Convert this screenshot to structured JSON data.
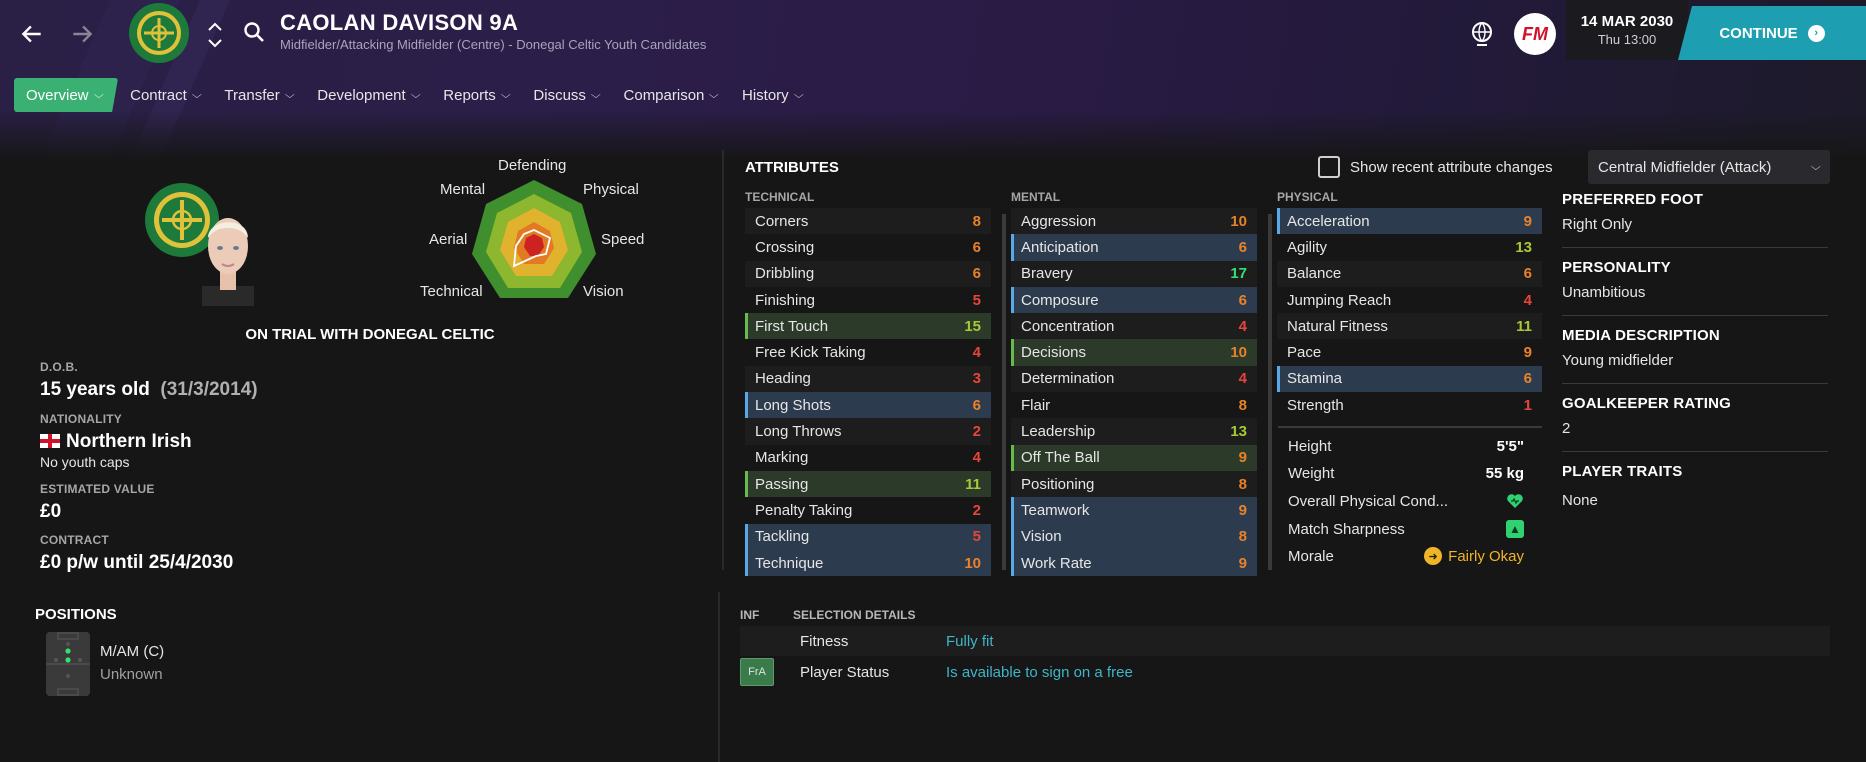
{
  "header": {
    "player_name": "CAOLAN DAVISON 9A",
    "subtitle": "Midfielder/Attacking Midfielder (Centre) - Donegal Celtic Youth Candidates",
    "date": "14 MAR 2030",
    "day_time": "Thu 13:00",
    "fm_logo": "FM",
    "continue_label": "CONTINUE",
    "accent_color": "#1d9fb1"
  },
  "tabs": [
    {
      "label": "Overview",
      "active": true
    },
    {
      "label": "Contract"
    },
    {
      "label": "Transfer"
    },
    {
      "label": "Development"
    },
    {
      "label": "Reports"
    },
    {
      "label": "Discuss"
    },
    {
      "label": "Comparison"
    },
    {
      "label": "History"
    }
  ],
  "radar": {
    "labels": {
      "defending": "Defending",
      "physical": "Physical",
      "speed": "Speed",
      "vision": "Vision",
      "technical": "Technical",
      "aerial": "Aerial",
      "mental": "Mental"
    }
  },
  "profile": {
    "trial_text": "ON TRIAL WITH DONEGAL CELTIC",
    "dob_label": "D.O.B.",
    "age": "15 years old",
    "dob": "(31/3/2014)",
    "nationality_label": "NATIONALITY",
    "nationality": "Northern Irish",
    "caps": "No youth caps",
    "value_label": "ESTIMATED VALUE",
    "value": "£0",
    "contract_label": "CONTRACT",
    "contract": "£0 p/w until 25/4/2030"
  },
  "attributes": {
    "title": "ATTRIBUTES",
    "show_changes_label": "Show recent attribute changes",
    "role": "Central Midfielder (Attack)",
    "technical_head": "TECHNICAL",
    "mental_head": "MENTAL",
    "physical_head": "PHYSICAL",
    "technical": [
      {
        "name": "Corners",
        "value": "8"
      },
      {
        "name": "Crossing",
        "value": "6"
      },
      {
        "name": "Dribbling",
        "value": "6"
      },
      {
        "name": "Finishing",
        "value": "5"
      },
      {
        "name": "First Touch",
        "value": "15",
        "hl": "green"
      },
      {
        "name": "Free Kick Taking",
        "value": "4"
      },
      {
        "name": "Heading",
        "value": "3"
      },
      {
        "name": "Long Shots",
        "value": "6",
        "hl": "blue"
      },
      {
        "name": "Long Throws",
        "value": "2"
      },
      {
        "name": "Marking",
        "value": "4"
      },
      {
        "name": "Passing",
        "value": "11",
        "hl": "green"
      },
      {
        "name": "Penalty Taking",
        "value": "2"
      },
      {
        "name": "Tackling",
        "value": "5",
        "hl": "blue"
      },
      {
        "name": "Technique",
        "value": "10",
        "hl": "blue"
      }
    ],
    "mental": [
      {
        "name": "Aggression",
        "value": "10"
      },
      {
        "name": "Anticipation",
        "value": "6",
        "hl": "blue"
      },
      {
        "name": "Bravery",
        "value": "17"
      },
      {
        "name": "Composure",
        "value": "6",
        "hl": "blue"
      },
      {
        "name": "Concentration",
        "value": "4"
      },
      {
        "name": "Decisions",
        "value": "10",
        "hl": "green"
      },
      {
        "name": "Determination",
        "value": "4"
      },
      {
        "name": "Flair",
        "value": "8"
      },
      {
        "name": "Leadership",
        "value": "13"
      },
      {
        "name": "Off The Ball",
        "value": "9",
        "hl": "green"
      },
      {
        "name": "Positioning",
        "value": "8"
      },
      {
        "name": "Teamwork",
        "value": "9",
        "hl": "blue"
      },
      {
        "name": "Vision",
        "value": "8",
        "hl": "blue"
      },
      {
        "name": "Work Rate",
        "value": "9",
        "hl": "blue"
      }
    ],
    "physical": [
      {
        "name": "Acceleration",
        "value": "9",
        "hl": "blue"
      },
      {
        "name": "Agility",
        "value": "13"
      },
      {
        "name": "Balance",
        "value": "6"
      },
      {
        "name": "Jumping Reach",
        "value": "4"
      },
      {
        "name": "Natural Fitness",
        "value": "11"
      },
      {
        "name": "Pace",
        "value": "9"
      },
      {
        "name": "Stamina",
        "value": "6",
        "hl": "blue"
      },
      {
        "name": "Strength",
        "value": "1"
      }
    ],
    "height_label": "Height",
    "height": "5'5\"",
    "weight_label": "Weight",
    "weight": "55 kg",
    "condition_label": "Overall Physical Cond...",
    "sharpness_label": "Match Sharpness",
    "morale_label": "Morale",
    "morale": "Fairly Okay"
  },
  "right_info": {
    "foot_label": "PREFERRED FOOT",
    "foot": "Right Only",
    "personality_label": "PERSONALITY",
    "personality": "Unambitious",
    "media_label": "MEDIA DESCRIPTION",
    "media": "Young midfielder",
    "gk_label": "GOALKEEPER RATING",
    "gk": "2",
    "traits_label": "PLAYER TRAITS",
    "traits": "None"
  },
  "positions": {
    "title": "POSITIONS",
    "main": "M/AM (C)",
    "sub": "Unknown"
  },
  "selection": {
    "inf_head": "INF",
    "details_head": "SELECTION DETAILS",
    "fitness_label": "Fitness",
    "fitness": "Fully fit",
    "status_badge": "FrA",
    "status_label": "Player Status",
    "status": "Is available to sign on a free"
  }
}
